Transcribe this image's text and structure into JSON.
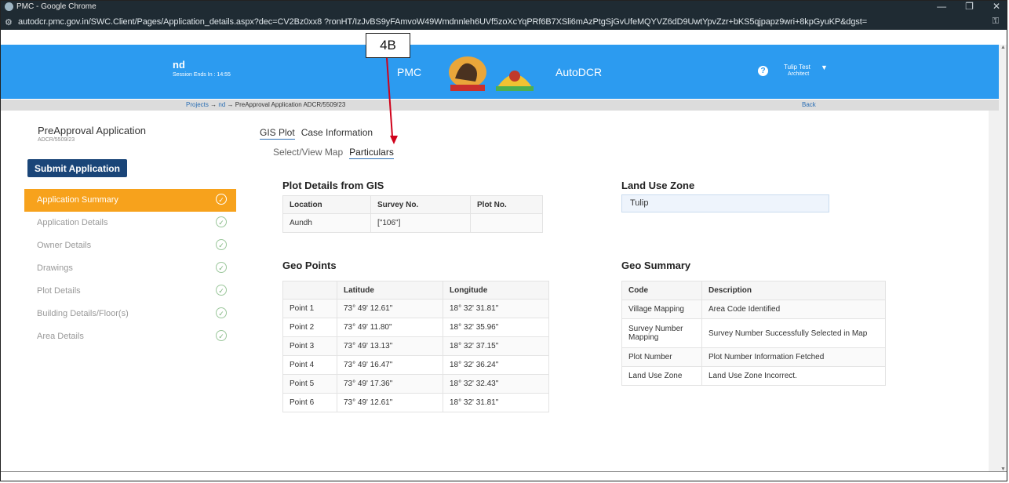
{
  "browser": {
    "window_title": "PMC - Google Chrome",
    "url": "autodcr.pmc.gov.in/SWC.Client/Pages/Application_details.aspx?dec=CV2Bz0xx8                              ?ronHT/IzJvBS9yFAmvoW49Wmdnnleh6UVf5zoXcYqPRf6B7XSli6mAzPtgSjGvUfeMQYVZ6dD9UwtYpvZzr+bKS5qjpapz9wri+8kpGyuKP&dgst=",
    "controls": {
      "minimize": "—",
      "restore": "❐",
      "close": "✕"
    }
  },
  "header": {
    "user_short": "nd",
    "session": "Session Ends In : 14:55",
    "brand_left": "PMC",
    "brand_right": "AutoDCR",
    "user_name": "Tulip Test",
    "user_role": "Architect"
  },
  "breadcrumb": {
    "items": [
      "Projects",
      "nd",
      "PreApproval Application ADCR/5509/23"
    ],
    "separator": "→",
    "back": "Back"
  },
  "sidebar": {
    "title": "PreApproval Application",
    "app_id": "ADCR/5509/23",
    "submit_label": "Submit Application",
    "items": [
      {
        "label": "Application Summary",
        "active": true
      },
      {
        "label": "Application Details",
        "active": false
      },
      {
        "label": "Owner Details",
        "active": false
      },
      {
        "label": "Drawings",
        "active": false
      },
      {
        "label": "Plot Details",
        "active": false
      },
      {
        "label": "Building Details/Floor(s)",
        "active": false
      },
      {
        "label": "Area Details",
        "active": false
      }
    ],
    "check_glyph": "✓"
  },
  "main": {
    "tabs": [
      {
        "label": "GIS Plot",
        "active": true
      },
      {
        "label": "Case Information",
        "active": false
      }
    ],
    "subtabs": [
      {
        "label": "Select/View Map",
        "active": false
      },
      {
        "label": "Particulars",
        "active": true
      }
    ],
    "plot_details": {
      "title": "Plot Details from GIS",
      "headers": [
        "Location",
        "Survey No.",
        "Plot No."
      ],
      "rows": [
        [
          "Aundh",
          "[\"106\"]",
          ""
        ]
      ]
    },
    "land_use_zone": {
      "title": "Land Use Zone",
      "value": "Tulip"
    },
    "geo_points": {
      "title": "Geo Points",
      "headers": [
        "",
        "Latitude",
        "Longitude"
      ],
      "rows": [
        [
          "Point 1",
          "73° 49' 12.61\"",
          "18° 32' 31.81\""
        ],
        [
          "Point 2",
          "73° 49' 11.80\"",
          "18° 32' 35.96\""
        ],
        [
          "Point 3",
          "73° 49' 13.13\"",
          "18° 32' 37.15\""
        ],
        [
          "Point 4",
          "73° 49' 16.47\"",
          "18° 32' 36.24\""
        ],
        [
          "Point 5",
          "73° 49' 17.36\"",
          "18° 32' 32.43\""
        ],
        [
          "Point 6",
          "73° 49' 12.61\"",
          "18° 32' 31.81\""
        ]
      ]
    },
    "geo_summary": {
      "title": "Geo Summary",
      "headers": [
        "Code",
        "Description"
      ],
      "rows": [
        [
          "Village Mapping",
          "Area Code Identified"
        ],
        [
          "Survey Number Mapping",
          "Survey Number Successfully Selected in Map"
        ],
        [
          "Plot Number",
          "Plot Number Information Fetched"
        ],
        [
          "Land Use Zone",
          "Land Use Zone Incorrect."
        ]
      ]
    }
  },
  "annotation": {
    "label": "4B",
    "arrow_color": "#d0021b"
  },
  "colors": {
    "header_blue": "#2c9bf0",
    "active_orange": "#f7a21c",
    "submit_navy": "#1a4578"
  }
}
